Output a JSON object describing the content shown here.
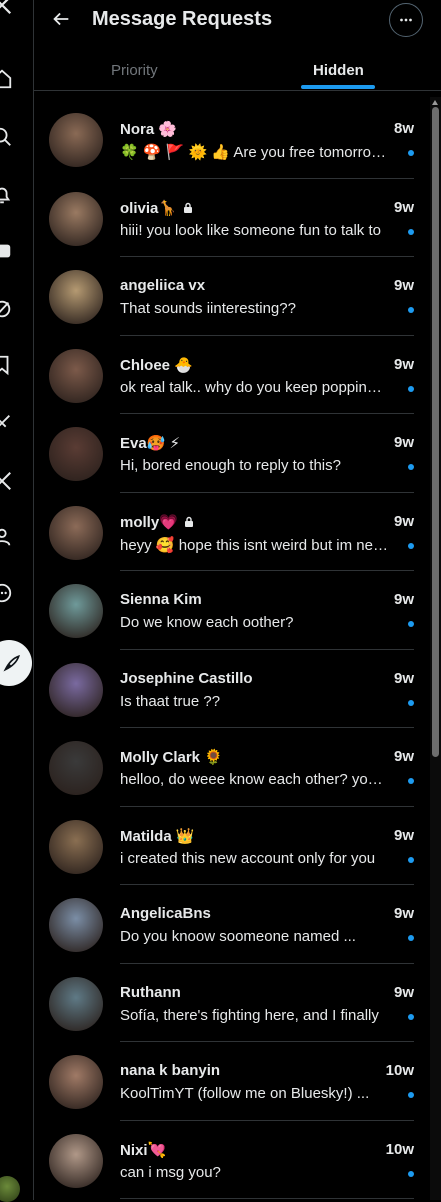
{
  "header": {
    "title": "Message Requests"
  },
  "tabs": [
    {
      "label": "Priority",
      "active": false
    },
    {
      "label": "Hidden",
      "active": true
    }
  ],
  "colors": {
    "accent": "#1d9bf0",
    "background": "#000000",
    "text": "#e7e9ea",
    "muted": "#71767b"
  },
  "conversations": [
    {
      "name": "Nora 🌸",
      "locked": false,
      "time": "8w",
      "message": "🍀 🍄 🚩 🌞 👍 Are you free tomorrow?",
      "unread": true,
      "avatar_color": "#8a6a55"
    },
    {
      "name": "olivia🦒",
      "locked": true,
      "time": "9w",
      "message": "hiii! you look like someone fun to talk to",
      "unread": true,
      "avatar_color": "#9a7a62"
    },
    {
      "name": "angeliica vx",
      "locked": false,
      "time": "9w",
      "message": "That sounds iinteresting??",
      "unread": true,
      "avatar_color": "#b59a72"
    },
    {
      "name": "Chloee 🐣",
      "locked": false,
      "time": "9w",
      "message": "ok real talk.. why do you keep popping up",
      "unread": true,
      "avatar_color": "#7c5a4a"
    },
    {
      "name": "Eva🥵 ⚡",
      "locked": false,
      "time": "9w",
      "message": "Hi, bored enough to reply to this?",
      "unread": true,
      "avatar_color": "#5a3c34"
    },
    {
      "name": "molly💗",
      "locked": true,
      "time": "9w",
      "message": "heyy 🥰 hope this isnt weird but im new here",
      "unread": true,
      "avatar_color": "#8c6b58"
    },
    {
      "name": "Sienna Kim",
      "locked": false,
      "time": "9w",
      "message": "Do we know each oother?",
      "unread": true,
      "avatar_color": "#6f9a9a"
    },
    {
      "name": "Josephine Castillo",
      "locked": false,
      "time": "9w",
      "message": "Is thaat true ??",
      "unread": true,
      "avatar_color": "#7a6aa0"
    },
    {
      "name": "Molly Clark 🌻",
      "locked": false,
      "time": "9w",
      "message": "helloo, do weee know each other? you look",
      "unread": true,
      "avatar_color": "#3a3a3a"
    },
    {
      "name": "Matilda 👑",
      "locked": false,
      "time": "9w",
      "message": "i created this new account only for you",
      "unread": true,
      "avatar_color": "#8a6f52"
    },
    {
      "name": "AngelicaBns",
      "locked": false,
      "time": "9w",
      "message": "Do you knoow soomeone named ...",
      "unread": true,
      "avatar_color": "#7b8ea6"
    },
    {
      "name": "Ruthann",
      "locked": false,
      "time": "9w",
      "message": "Sofía, there's fighting here, and I finally",
      "unread": true,
      "avatar_color": "#5f7a86"
    },
    {
      "name": "nana k banyin",
      "locked": false,
      "time": "10w",
      "message": "KoolTimYT (follow me on Bluesky!) ...",
      "unread": true,
      "avatar_color": "#a07a66"
    },
    {
      "name": "Nixi💘",
      "locked": false,
      "time": "10w",
      "message": "can i msg you?",
      "unread": true,
      "avatar_color": "#b09888"
    }
  ]
}
